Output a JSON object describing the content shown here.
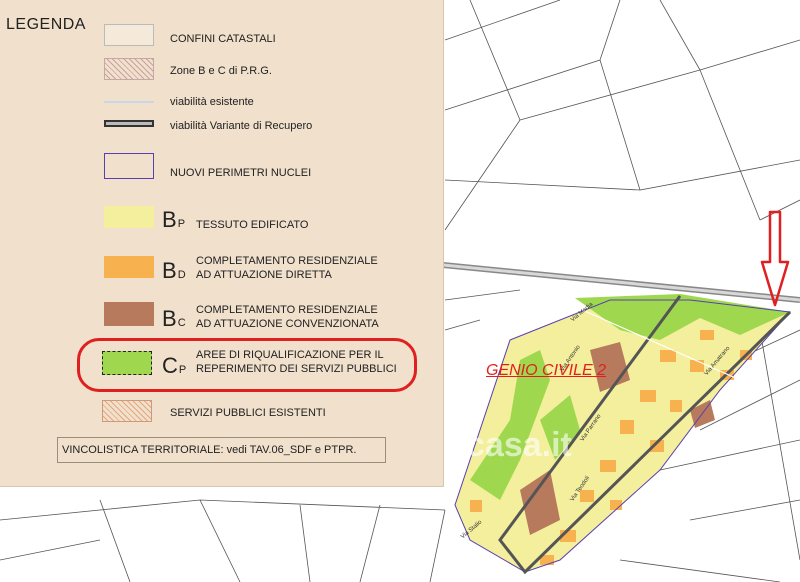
{
  "legend": {
    "title": "LEGENDA",
    "items": [
      {
        "label": "CONFINI CATASTALI"
      },
      {
        "label": "Zone B e C di P.R.G."
      },
      {
        "label": "viabilità esistente"
      },
      {
        "label": "viabilità Variante di Recupero"
      },
      {
        "label": "NUOVI PERIMETRI NUCLEI"
      },
      {
        "code": "B",
        "sub": "P",
        "label": "TESSUTO EDIFICATO",
        "color": "#f3ef9c"
      },
      {
        "code": "B",
        "sub": "D",
        "line1": "COMPLETAMENTO RESIDENZIALE",
        "line2": "AD ATTUAZIONE DIRETTA",
        "color": "#f7b24f"
      },
      {
        "code": "B",
        "sub": "C",
        "line1": "COMPLETAMENTO RESIDENZIALE",
        "line2": "AD ATTUAZIONE CONVENZIONATA",
        "color": "#b77a5c"
      },
      {
        "code": "C",
        "sub": "P",
        "line1": "AREE DI RIQUALIFICAZIONE PER IL",
        "line2": "REPERIMENTO DEI SERVIZI PUBBLICI",
        "color": "#9fd84e"
      },
      {
        "label": "SERVIZI PUBBLICI ESISTENTI"
      }
    ],
    "vincolistica": "VINCOLISTICA TERRITORIALE: vedi TAV.06_SDF e PTPR."
  },
  "map": {
    "annotation": "GENIO CIVILE 2",
    "watermark": "casa.it",
    "streets": [
      "Via Media",
      "Via Antonio",
      "Via Parrano",
      "Via Teodoli",
      "Via Amatrano",
      "Via Stalio"
    ]
  },
  "colors": {
    "tessuto": "#f3ef9c",
    "completamento_diretta": "#f7b24f",
    "completamento_convenzionata": "#b77a5c",
    "riqualificazione": "#9fd84e",
    "perimetro": "#5a3fb0",
    "highlight": "#e02020"
  }
}
